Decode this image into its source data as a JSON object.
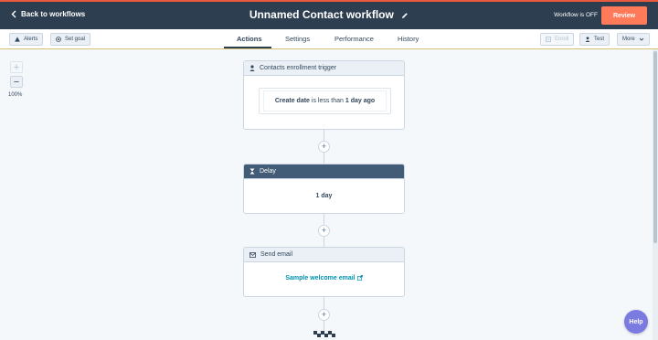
{
  "header": {
    "back_label": "Back to workflows",
    "title": "Unnamed Contact workflow",
    "status": "Workflow is OFF",
    "review_label": "Review"
  },
  "toolbar": {
    "alerts_label": "Alerts",
    "set_goal_label": "Set goal",
    "enroll_label": "Enroll",
    "test_label": "Test",
    "more_label": "More"
  },
  "tabs": [
    "Actions",
    "Settings",
    "Performance",
    "History"
  ],
  "active_tab": "Actions",
  "zoom": {
    "level": "100%",
    "plus": "+",
    "minus": "−"
  },
  "steps": {
    "trigger": {
      "header": "Contacts enrollment trigger",
      "criteria_field": "Create date",
      "criteria_operator": "is less than",
      "criteria_value": "1 day ago"
    },
    "delay": {
      "header": "Delay",
      "value": "1 day"
    },
    "email": {
      "header": "Send email",
      "email_name": "Sample welcome email"
    }
  },
  "add_action_symbol": "+",
  "help_label": "Help",
  "colors": {
    "topbar": "#2d3e50",
    "accent_orange": "#ff7a59",
    "link": "#0091ae",
    "delay_header": "#425b76",
    "help": "#7b7ae0"
  }
}
